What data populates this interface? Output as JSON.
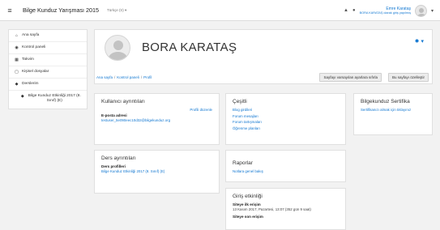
{
  "topbar": {
    "menu_icon": "hamburger-icon",
    "site_title": "Bilge Kunduz Yarışması 2015",
    "language": "Türkçe (tr) ▾",
    "notification_icon": "bell-icon",
    "message_icon": "chat-icon",
    "user_name": "Emre Karataş",
    "user_status": "BORA KARATAŞ olarak giriş yapılmış",
    "user_menu_caret": "▾"
  },
  "sidebar": {
    "items": [
      {
        "icon": "home-icon",
        "glyph": "⌂",
        "label": "Ana sayfa"
      },
      {
        "icon": "dashboard-icon",
        "glyph": "◉",
        "label": "Kontrol paneli"
      },
      {
        "icon": "calendar-icon",
        "glyph": "▦",
        "label": "Takvim"
      },
      {
        "icon": "file-icon",
        "glyph": "▢",
        "label": "Kişisel dosyalar"
      },
      {
        "icon": "graduation-cap-icon",
        "glyph": "◆",
        "label": "Derslerim"
      }
    ],
    "course": {
      "icon": "graduation-cap-icon",
      "glyph": "◆",
      "label": "Bilge Kunduz Etkinliği 2017 (8. Sınıf) (E)"
    }
  },
  "header": {
    "profile_name": "BORA KARATAŞ",
    "settings_icon": "gear-icon",
    "breadcrumb": [
      "Ana sayfa",
      "Kontrol paneli",
      "Profil"
    ],
    "reset_button": "Sayfayı varsayılan ayarlara sıfırla",
    "customize_button": "Bu sayfayı özelleştir"
  },
  "user_details": {
    "title": "Kullanıcı ayrıntıları",
    "edit_link": "Profili düzenle",
    "email_label": "E-posta adresi",
    "email_value": "testuser_5e090eec10d32@bilgekunduz.org"
  },
  "misc": {
    "title": "Çeşitli",
    "links": [
      "Blog girdileri",
      "Forum mesajları",
      "Forum tartışmaları",
      "Öğrenme planları"
    ]
  },
  "certificate": {
    "title": "Bilgekunduz Sertifika",
    "text": "Sertifikanızı almak için tıklayınız"
  },
  "course_details": {
    "title": "Ders ayrıntıları",
    "profiles_label": "Ders profilleri",
    "course_link": "Bilge Kunduz Etkinliği 2017 (8. Sınıf) (E)"
  },
  "reports": {
    "title": "Raporlar",
    "link": "Notlara genel bakış"
  },
  "login_activity": {
    "title": "Giriş etkinliği",
    "first_access_label": "Siteye ilk erişim",
    "first_access_value": "13 Kasım 2017, Pazartesi, 13:07  (352 gün 9 saat)",
    "last_access_label": "Siteye son erişim"
  }
}
